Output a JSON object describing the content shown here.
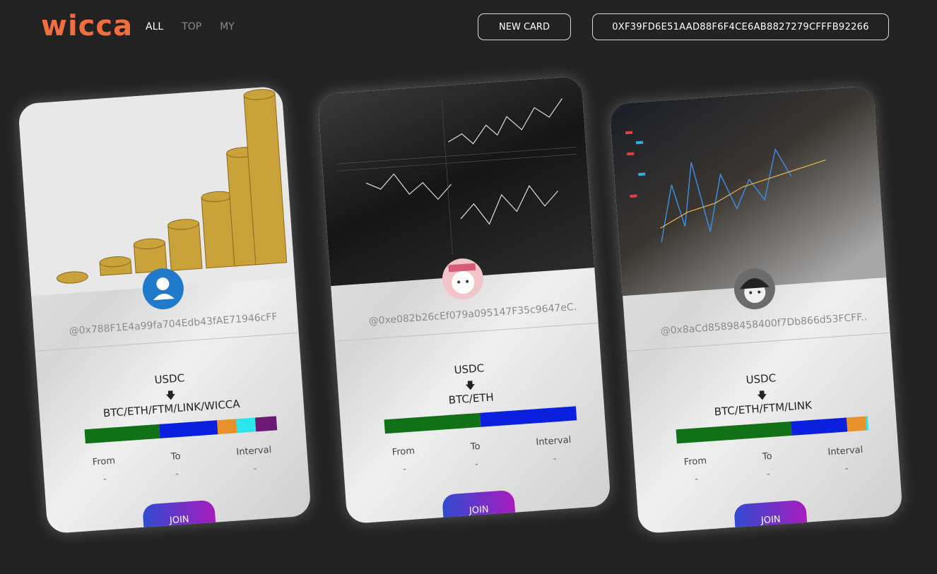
{
  "header": {
    "logo": "wicca",
    "nav": [
      {
        "label": "ALL",
        "active": true
      },
      {
        "label": "TOP",
        "active": false
      },
      {
        "label": "MY",
        "active": false
      }
    ],
    "new_card_label": "NEW CARD",
    "wallet_address": "0XF39FD6E51AAD88F6F4CE6AB8827279CFFFB92266"
  },
  "colors": {
    "background": "#222222",
    "logo": "#f36e3f",
    "bar_green": "#107117",
    "bar_blue": "#0b1fdf",
    "bar_orange": "#e8912a",
    "bar_cyan": "#2ce5ea",
    "bar_purple": "#6b1a73",
    "join_gradient_start": "#2f4bd0",
    "join_gradient_end": "#a81cbf"
  },
  "cards": [
    {
      "image": "coin-stacks-image",
      "avatar": "user-silhouette-icon",
      "address": "@0x788F1E4a99fa704Edb43fAE71946cFF...",
      "from_token": "USDC",
      "arrow": "🡇",
      "to_tokens": "BTC/ETH/FTM/LINK/WICCA",
      "allocation": [
        {
          "color": "#107117",
          "weight": 39
        },
        {
          "color": "#0b1fdf",
          "weight": 30
        },
        {
          "color": "#e8912a",
          "weight": 10
        },
        {
          "color": "#2ce5ea",
          "weight": 10
        },
        {
          "color": "#6b1a73",
          "weight": 11
        }
      ],
      "labels": {
        "from": "From",
        "to": "To",
        "interval": "Interval"
      },
      "values": {
        "from": "-",
        "to": "-",
        "interval": "-"
      },
      "join_label": "JOIN"
    },
    {
      "image": "trading-screen-image",
      "avatar": "anime-avatar-pink",
      "address": "@0xe082b26cEf079a095147F35c9647eC...",
      "from_token": "USDC",
      "arrow": "🡇",
      "to_tokens": "BTC/ETH",
      "allocation": [
        {
          "color": "#107117",
          "weight": 50
        },
        {
          "color": "#0b1fdf",
          "weight": 50
        }
      ],
      "labels": {
        "from": "From",
        "to": "To",
        "interval": "Interval"
      },
      "values": {
        "from": "-",
        "to": "-",
        "interval": "-"
      },
      "join_label": "JOIN"
    },
    {
      "image": "candlestick-chart-image",
      "avatar": "anime-avatar-dark",
      "address": "@0x8aCd85898458400f7Db866d53FCFF...",
      "from_token": "USDC",
      "arrow": "🡇",
      "to_tokens": "BTC/ETH/FTM/LINK",
      "allocation": [
        {
          "color": "#107117",
          "weight": 60
        },
        {
          "color": "#0b1fdf",
          "weight": 29
        },
        {
          "color": "#e8912a",
          "weight": 10
        },
        {
          "color": "#2ce5ea",
          "weight": 1
        }
      ],
      "labels": {
        "from": "From",
        "to": "To",
        "interval": "Interval"
      },
      "values": {
        "from": "-",
        "to": "-",
        "interval": "-"
      },
      "join_label": "JOIN"
    }
  ]
}
